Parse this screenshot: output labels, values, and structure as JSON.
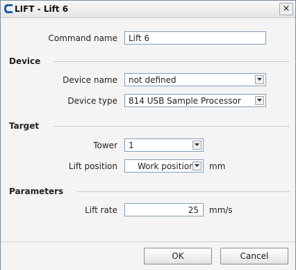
{
  "window": {
    "title": "LIFT - Lift 6",
    "close_glyph": "×"
  },
  "command": {
    "label": "Command name",
    "value": "Lift 6"
  },
  "device": {
    "header": "Device",
    "name_label": "Device name",
    "name_value": "not defined",
    "type_label": "Device type",
    "type_value": "814 USB Sample Processor"
  },
  "target": {
    "header": "Target",
    "tower_label": "Tower",
    "tower_value": "1",
    "lift_label": "Lift position",
    "lift_value": "Work position",
    "lift_unit": "mm"
  },
  "parameters": {
    "header": "Parameters",
    "rate_label": "Lift rate",
    "rate_value": "25",
    "rate_unit": "mm/s"
  },
  "buttons": {
    "ok": "OK",
    "cancel": "Cancel"
  },
  "colors": {
    "logo": "#1f5fa8",
    "field_border": "#7f9db9"
  }
}
